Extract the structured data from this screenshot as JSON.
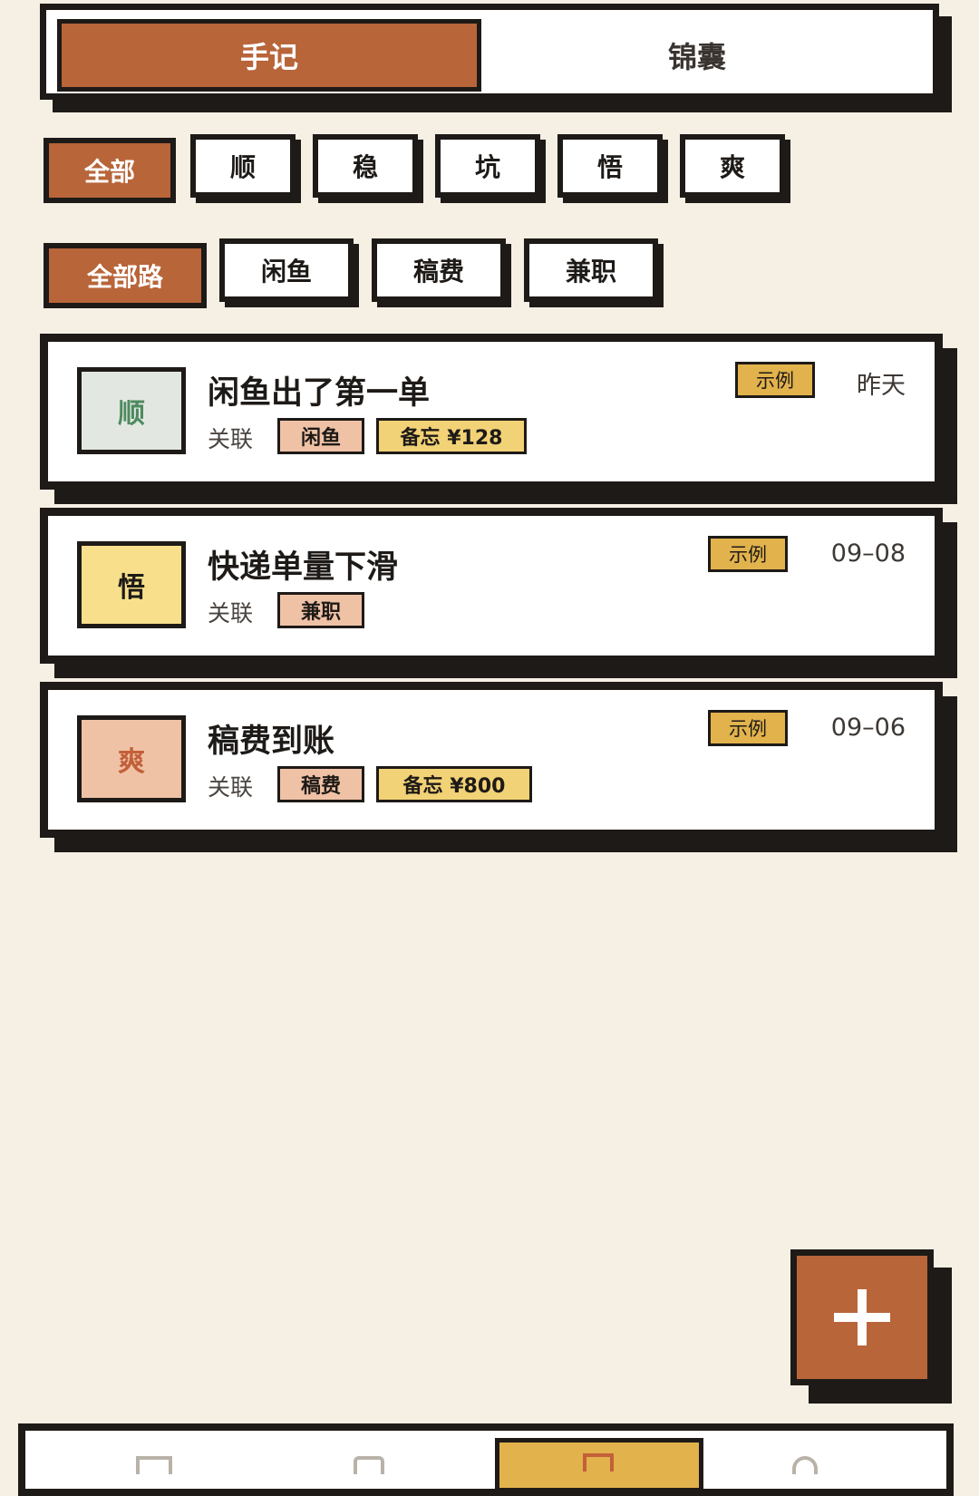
{
  "tabs": {
    "notes": "手记",
    "tips": "锦囊"
  },
  "mood_filters": [
    "全部",
    "顺",
    "稳",
    "坑",
    "悟",
    "爽"
  ],
  "path_filters": [
    "全部路",
    "闲鱼",
    "稿费",
    "兼职"
  ],
  "notes": [
    {
      "mood": "顺",
      "title": "闲鱼出了第一单",
      "relation_label": "关联",
      "path_tag": "闲鱼",
      "memo_tag": "备忘 ¥128",
      "example_tag": "示例",
      "date": "昨天"
    },
    {
      "mood": "悟",
      "title": "快递单量下滑",
      "relation_label": "关联",
      "path_tag": "兼职",
      "example_tag": "示例",
      "date": "09–08"
    },
    {
      "mood": "爽",
      "title": "稿费到账",
      "relation_label": "关联",
      "path_tag": "稿费",
      "memo_tag": "备忘 ¥800",
      "example_tag": "示例",
      "date": "09–06"
    }
  ],
  "fab": {
    "icon": "plus-icon"
  },
  "colors": {
    "accent": "#b8653a",
    "ink": "#1e1a17",
    "background": "#f5efe4",
    "mood_shun_bg": "#e2e8e1",
    "mood_shun_text": "#4e8a5e",
    "mood_wu_bg": "#f7df8c",
    "mood_shuang_bg": "#efc2a6",
    "mood_shuang_text": "#c2603a",
    "example_tag": "#e2b24c",
    "memo_tag": "#f2d276",
    "path_tag": "#efc2a6"
  }
}
